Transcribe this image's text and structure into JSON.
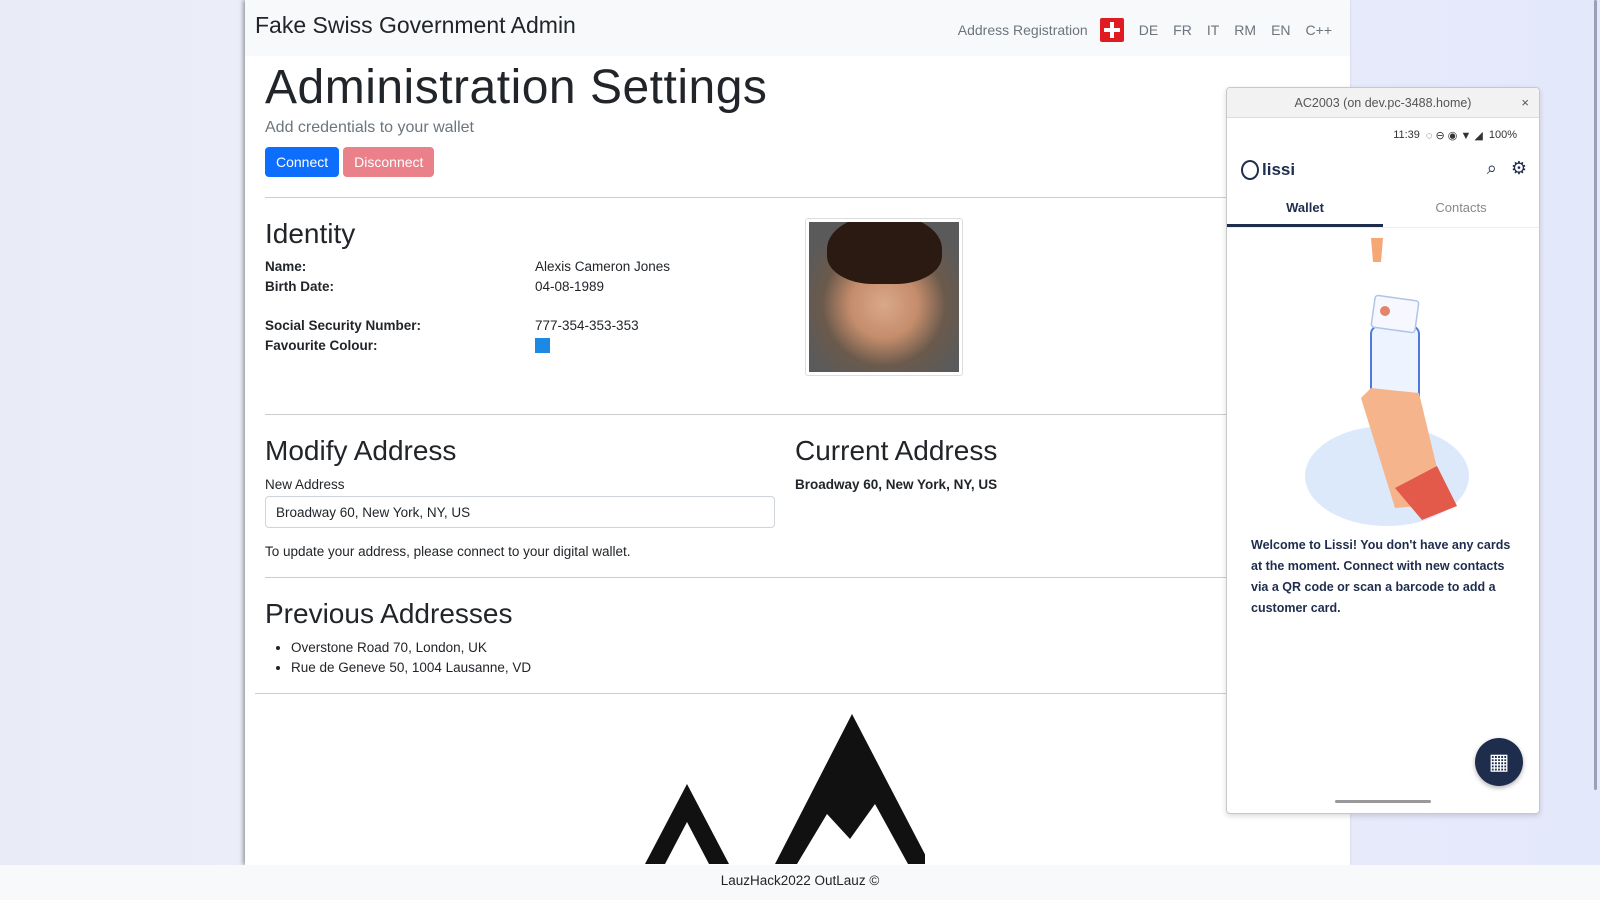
{
  "navbar": {
    "brand": "Fake Swiss Government Admin",
    "link_address_registration": "Address Registration",
    "languages": [
      "DE",
      "FR",
      "IT",
      "RM",
      "EN",
      "C++"
    ]
  },
  "header": {
    "title": "Administration Settings",
    "subtitle": "Add credentials to your wallet",
    "connect_label": "Connect",
    "disconnect_label": "Disconnect"
  },
  "identity": {
    "heading": "Identity",
    "fields": [
      {
        "key": "Name:",
        "value": "Alexis Cameron Jones"
      },
      {
        "key": "Birth Date:",
        "value": "04-08-1989"
      },
      {
        "key": "Social Security Number:",
        "value": "777-354-353-353"
      },
      {
        "key": "Favourite Colour:",
        "value": ""
      }
    ],
    "favourite_colour": "#1e88e5"
  },
  "modify_address": {
    "heading": "Modify Address",
    "label": "New Address",
    "input_value": "Broadway 60, New York, NY, US",
    "note": "To update your address, please connect to your digital wallet."
  },
  "current_address": {
    "heading": "Current Address",
    "value": "Broadway 60, New York, NY, US"
  },
  "previous_addresses": {
    "heading": "Previous Addresses",
    "items": [
      "Overstone Road 70, London, UK",
      "Rue de Geneve 50, 1004 Lausanne, VD"
    ]
  },
  "footer": {
    "text": "LauzHack2022 OutLauz ©"
  },
  "emulator": {
    "window_title": "AC2003 (on dev.pc-3488.home)",
    "close": "×",
    "status_time": "11:39",
    "battery": "100%",
    "app_name": "lissi",
    "tabs": [
      "Wallet",
      "Contacts"
    ],
    "welcome": "Welcome to Lissi! You don't have any cards at the moment. Connect with new contacts via a QR code or scan a barcode to add a customer card."
  }
}
